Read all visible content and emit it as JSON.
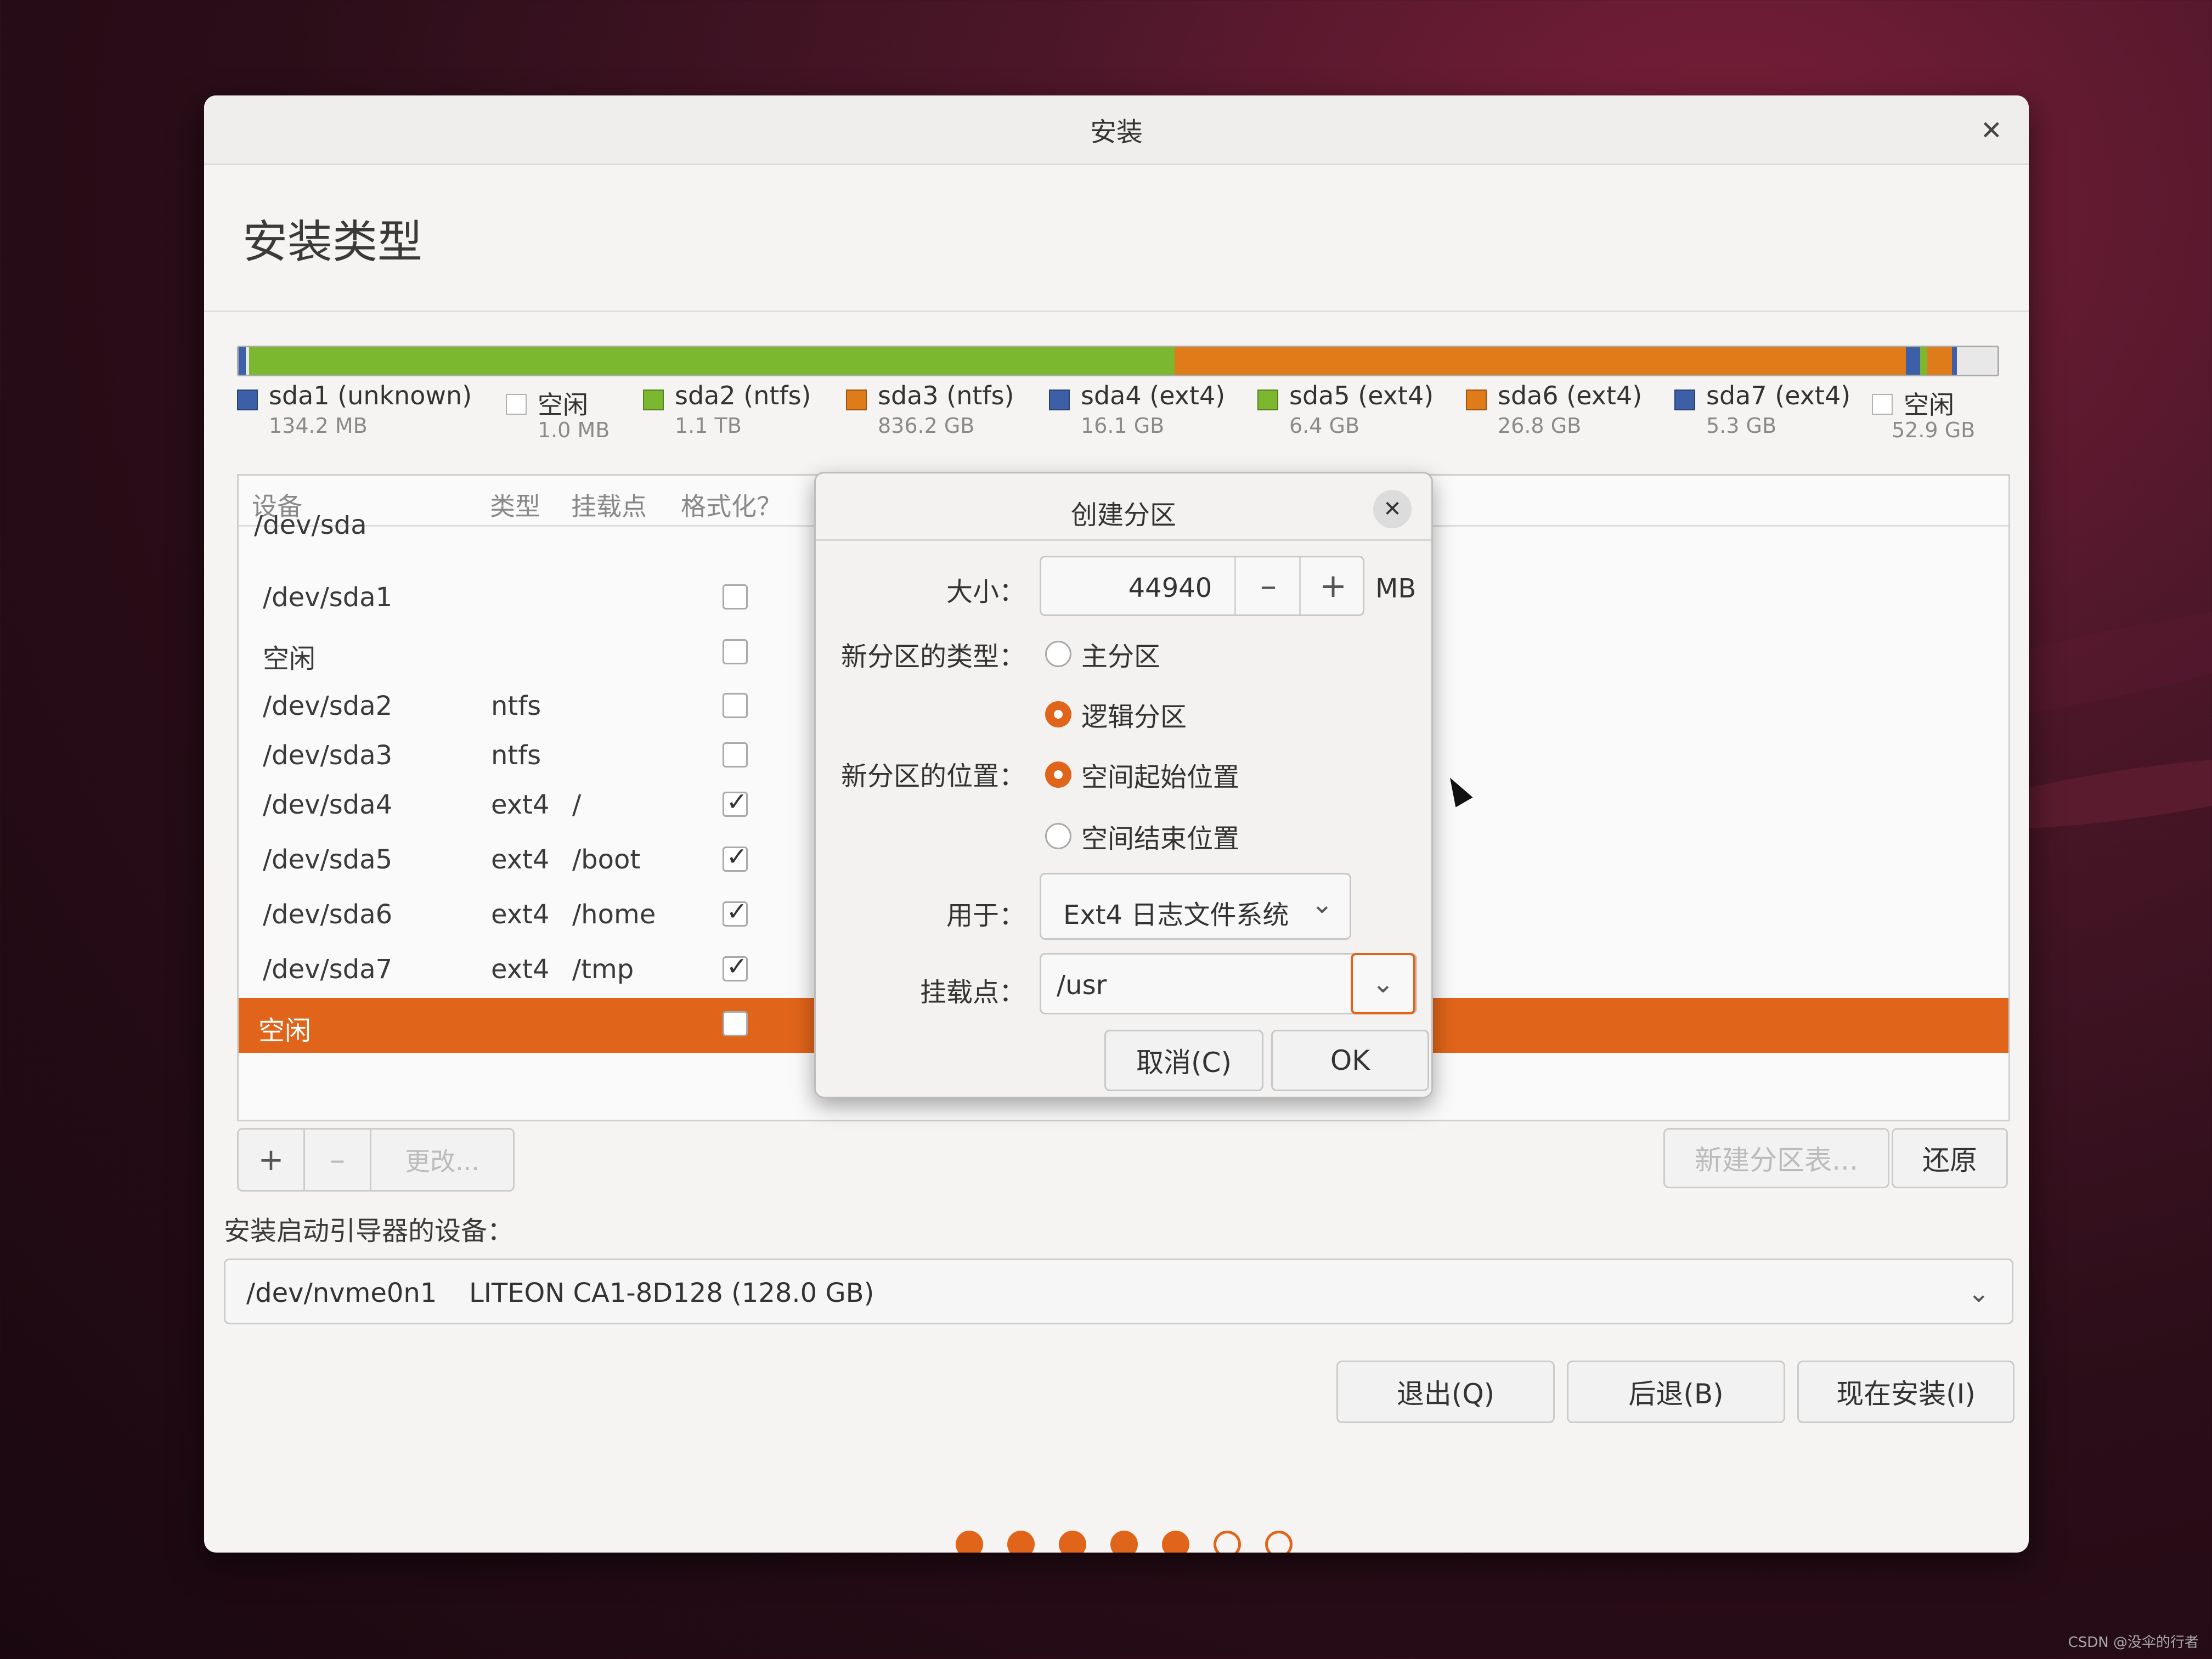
{
  "window": {
    "title": "安装",
    "close_icon": "close-icon"
  },
  "page": {
    "heading": "安装类型"
  },
  "disk_bar": [
    {
      "color": "#3d5fa8",
      "pct": 0.4
    },
    {
      "color": "#e8e8e8",
      "pct": 0.2
    },
    {
      "color": "#7cb82f",
      "pct": 52.6
    },
    {
      "color": "#e07b1a",
      "pct": 41.6
    },
    {
      "color": "#3d5fa8",
      "pct": 0.8
    },
    {
      "color": "#7cb82f",
      "pct": 0.4
    },
    {
      "color": "#e07b1a",
      "pct": 1.4
    },
    {
      "color": "#3d5fa8",
      "pct": 0.3
    },
    {
      "color": "#e8e8e8",
      "pct": 2.3
    }
  ],
  "legend": [
    {
      "name": "sda1 (unknown)",
      "size": "134.2 MB",
      "color": "#3d5fa8"
    },
    {
      "name": "空闲",
      "size": "1.0 MB",
      "color": "#ffffff"
    },
    {
      "name": "sda2 (ntfs)",
      "size": "1.1 TB",
      "color": "#7cb82f"
    },
    {
      "name": "sda3 (ntfs)",
      "size": "836.2 GB",
      "color": "#e07b1a"
    },
    {
      "name": "sda4 (ext4)",
      "size": "16.1 GB",
      "color": "#3d5fa8"
    },
    {
      "name": "sda5 (ext4)",
      "size": "6.4 GB",
      "color": "#7cb82f"
    },
    {
      "name": "sda6 (ext4)",
      "size": "26.8 GB",
      "color": "#e07b1a"
    },
    {
      "name": "sda7 (ext4)",
      "size": "5.3 GB",
      "color": "#3d5fa8"
    },
    {
      "name": "空闲",
      "size": "52.9 GB",
      "color": "#ffffff"
    }
  ],
  "table": {
    "headers": {
      "device": "设备",
      "type": "类型",
      "mount": "挂载点",
      "format": "格式化？"
    },
    "group": "/dev/sda",
    "rows": [
      {
        "device": "/dev/sda1",
        "type": "",
        "mount": "",
        "format": false
      },
      {
        "device": "空闲",
        "type": "",
        "mount": "",
        "format": false
      },
      {
        "device": "/dev/sda2",
        "type": "ntfs",
        "mount": "",
        "format": false
      },
      {
        "device": "/dev/sda3",
        "type": "ntfs",
        "mount": "",
        "format": false
      },
      {
        "device": "/dev/sda4",
        "type": "ext4",
        "mount": "/",
        "format": true
      },
      {
        "device": "/dev/sda5",
        "type": "ext4",
        "mount": "/boot",
        "format": true
      },
      {
        "device": "/dev/sda6",
        "type": "ext4",
        "mount": "/home",
        "format": true
      },
      {
        "device": "/dev/sda7",
        "type": "ext4",
        "mount": "/tmp",
        "format": true
      },
      {
        "device": "空闲",
        "type": "",
        "mount": "",
        "format": false,
        "selected": true
      }
    ]
  },
  "toolbar": {
    "add": "+",
    "remove": "–",
    "change": "更改...",
    "new_table": "新建分区表...",
    "revert": "还原"
  },
  "boot": {
    "label": "安装启动引导器的设备：",
    "device": "/dev/nvme0n1",
    "model": "LITEON CA1-8D128 (128.0 GB)"
  },
  "nav": {
    "quit": "退出(Q)",
    "back": "后退(B)",
    "install": "现在安装(I)"
  },
  "progress": {
    "steps_done": 5,
    "steps_total": 7,
    "accent": "#e0641a"
  },
  "dialog": {
    "title": "创建分区",
    "size_label": "大小：",
    "size_value": "44940",
    "size_unit": "MB",
    "minus": "–",
    "plus": "+",
    "type_label": "新分区的类型：",
    "type_primary": "主分区",
    "type_logical": "逻辑分区",
    "location_label": "新分区的位置：",
    "loc_begin": "空间起始位置",
    "loc_end": "空间结束位置",
    "use_label": "用于：",
    "use_value": "Ext4 日志文件系统",
    "mount_label": "挂载点：",
    "mount_value": "/usr",
    "cancel": "取消(C)",
    "ok": "OK"
  },
  "watermark": "CSDN @没伞的行者"
}
